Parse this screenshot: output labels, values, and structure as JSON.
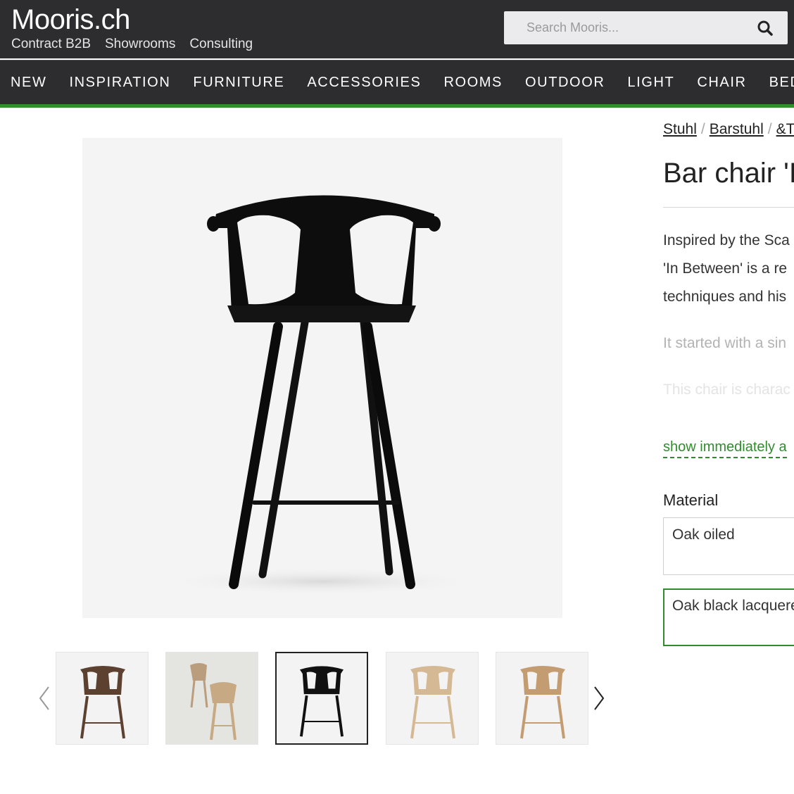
{
  "header": {
    "logo": "Mooris.ch",
    "sublinks": [
      "Contract B2B",
      "Showrooms",
      "Consulting"
    ],
    "search_placeholder": "Search Mooris..."
  },
  "nav": {
    "items": [
      "NEW",
      "INSPIRATION",
      "FURNITURE",
      "ACCESSORIES",
      "ROOMS",
      "OUTDOOR",
      "LIGHT",
      "CHAIR",
      "BED"
    ]
  },
  "product": {
    "breadcrumb": [
      "Stuhl",
      "Barstuhl",
      "&T"
    ],
    "title": "Bar chair 'In",
    "description": {
      "line1": "Inspired by the Sca",
      "line2": "'In Between' is a re",
      "line3": "techniques and his",
      "more1": "It started with a sin",
      "more2": "This chair is charac"
    },
    "show_more": "show immediately a",
    "material_label": "Material",
    "materials": [
      "Oak oiled",
      "Oak black lacquere"
    ],
    "selected_material_index": 1
  },
  "gallery": {
    "active_index": 2,
    "thumbnails": [
      "walnut-chair",
      "oak-chairs-group",
      "black-chair",
      "light-oak-chair",
      "oak-chair"
    ]
  },
  "colors": {
    "header_bg": "#2d2d2f",
    "accent_green": "#2f8d2b"
  }
}
